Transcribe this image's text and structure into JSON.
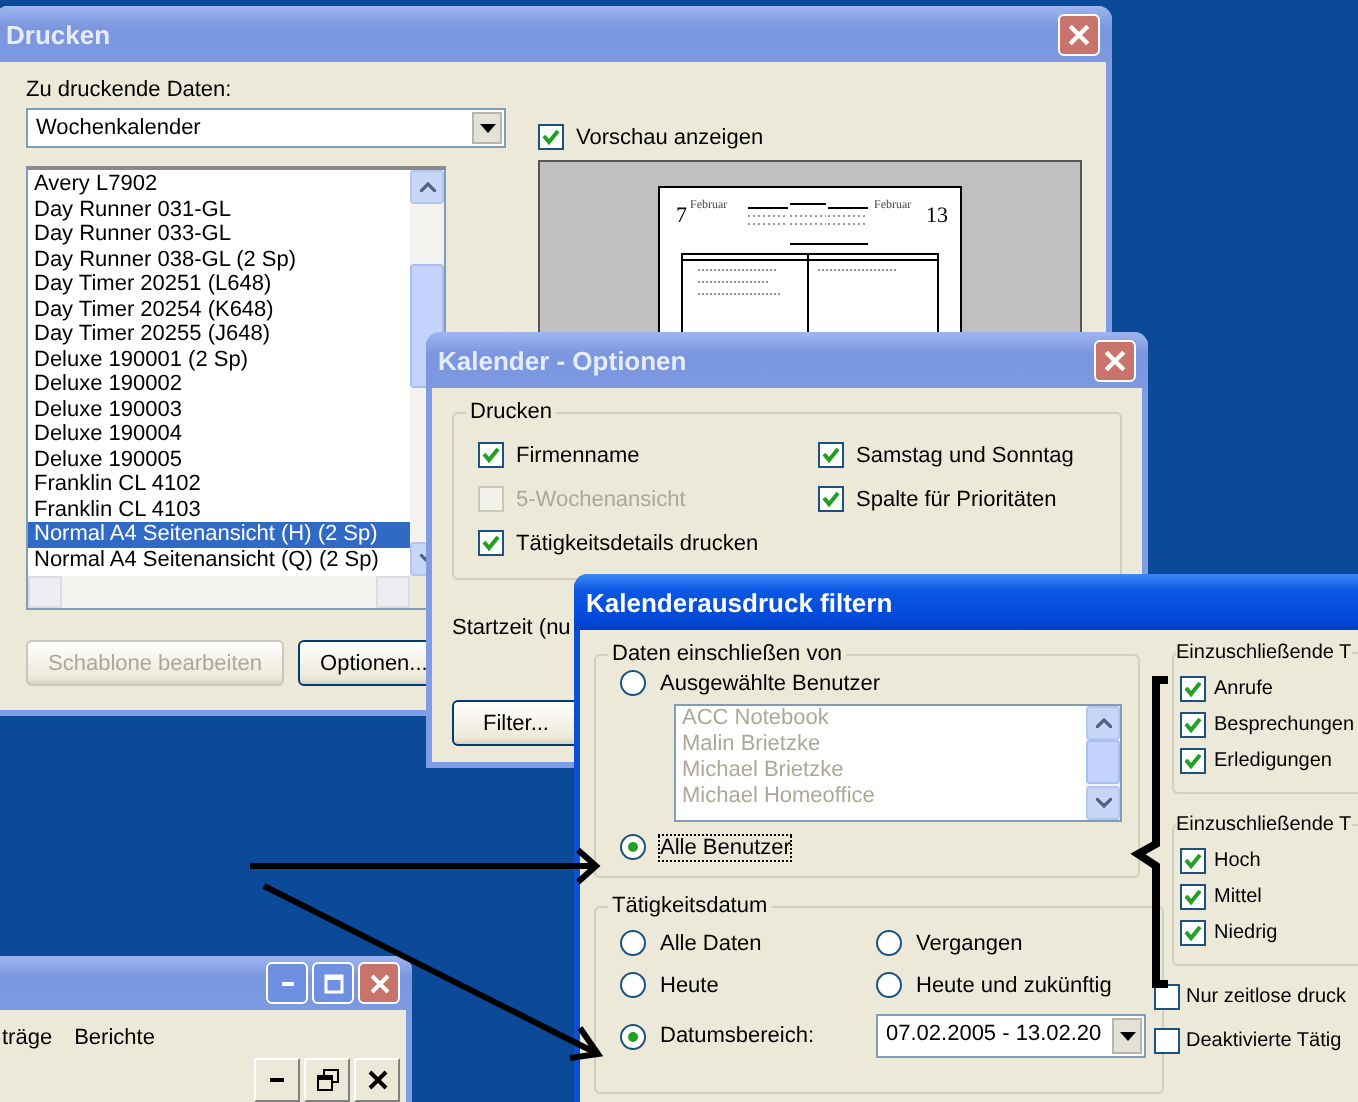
{
  "print_dialog": {
    "title": "Drucken",
    "active": false,
    "data_label": "Zu druckende Daten:",
    "data_select": "Wochenkalender",
    "preview_checkbox": {
      "label": "Vorschau anzeigen",
      "checked": true
    },
    "preview": {
      "day_start": "7",
      "month_start": "Februar",
      "month_end": "Februar",
      "day_end": "13"
    },
    "templates": [
      {
        "label": "Avery L7902",
        "selected": false
      },
      {
        "label": "Day Runner 031-GL",
        "selected": false
      },
      {
        "label": "Day Runner 033-GL",
        "selected": false
      },
      {
        "label": "Day Runner 038-GL (2 Sp)",
        "selected": false
      },
      {
        "label": "Day Timer 20251 (L648)",
        "selected": false
      },
      {
        "label": "Day Timer 20254 (K648)",
        "selected": false
      },
      {
        "label": "Day Timer 20255 (J648)",
        "selected": false
      },
      {
        "label": "Deluxe 190001 (2 Sp)",
        "selected": false
      },
      {
        "label": "Deluxe 190002",
        "selected": false
      },
      {
        "label": "Deluxe 190003",
        "selected": false
      },
      {
        "label": "Deluxe 190004",
        "selected": false
      },
      {
        "label": "Deluxe 190005",
        "selected": false
      },
      {
        "label": "Franklin CL 4102",
        "selected": false
      },
      {
        "label": "Franklin CL 4103",
        "selected": false
      },
      {
        "label": "Normal A4 Seitenansicht (H) (2 Sp)",
        "selected": true
      },
      {
        "label": "Normal A4 Seitenansicht (Q) (2 Sp)",
        "selected": false
      }
    ],
    "buttons": [
      {
        "label": "Schablone bearbeiten",
        "disabled": true
      },
      {
        "label": "Optionen...",
        "disabled": false
      }
    ]
  },
  "options_dialog": {
    "title": "Kalender - Optionen",
    "active": false,
    "group": "Drucken",
    "checkboxes": [
      {
        "label": "Firmenname",
        "checked": true,
        "disabled": false
      },
      {
        "label": "Samstag und Sonntag",
        "checked": true,
        "disabled": false
      },
      {
        "label": "5-Wochenansicht",
        "checked": false,
        "disabled": true
      },
      {
        "label": "Spalte für Prioritäten",
        "checked": true,
        "disabled": false
      },
      {
        "label": "Tätigkeitsdetails drucken",
        "checked": true,
        "disabled": false
      }
    ],
    "start_label": "Startzeit (nu",
    "filter_button": "Filter..."
  },
  "filter_dialog": {
    "title": "Kalenderausdruck filtern",
    "active": true,
    "users_group": {
      "title": "Daten einschließen von",
      "options": [
        {
          "label": "Ausgewählte Benutzer",
          "selected": false
        },
        {
          "label": "Alle Benutzer",
          "selected": true
        }
      ],
      "users": [
        "ACC Notebook",
        "Malin Brietzke",
        "Michael Brietzke",
        "Michael Homeoffice"
      ]
    },
    "date_group": {
      "title": "Tätigkeitsdatum",
      "options": [
        {
          "label": "Alle Daten",
          "selected": false
        },
        {
          "label": "Vergangen",
          "selected": false
        },
        {
          "label": "Heute",
          "selected": false
        },
        {
          "label": "Heute und zukünftig",
          "selected": false
        },
        {
          "label": "Datumsbereich:",
          "selected": true
        }
      ],
      "range": "07.02.2005 - 13.02.20"
    },
    "type_groups": [
      {
        "title": "Einzuschließende T",
        "items": [
          {
            "label": "Anrufe",
            "checked": true
          },
          {
            "label": "Besprechungen",
            "checked": true
          },
          {
            "label": "Erledigungen",
            "checked": true
          }
        ]
      },
      {
        "title": "Einzuschließende T",
        "items": [
          {
            "label": "Hoch",
            "checked": true
          },
          {
            "label": "Mittel",
            "checked": true
          },
          {
            "label": "Niedrig",
            "checked": true
          }
        ]
      }
    ],
    "extra_checks": [
      {
        "label": "Nur zeitlose druck",
        "checked": false
      },
      {
        "label": "Deaktivierte Tätig",
        "checked": false
      }
    ]
  },
  "back_window": {
    "active": false,
    "menu": [
      "träge",
      "Berichte"
    ]
  }
}
